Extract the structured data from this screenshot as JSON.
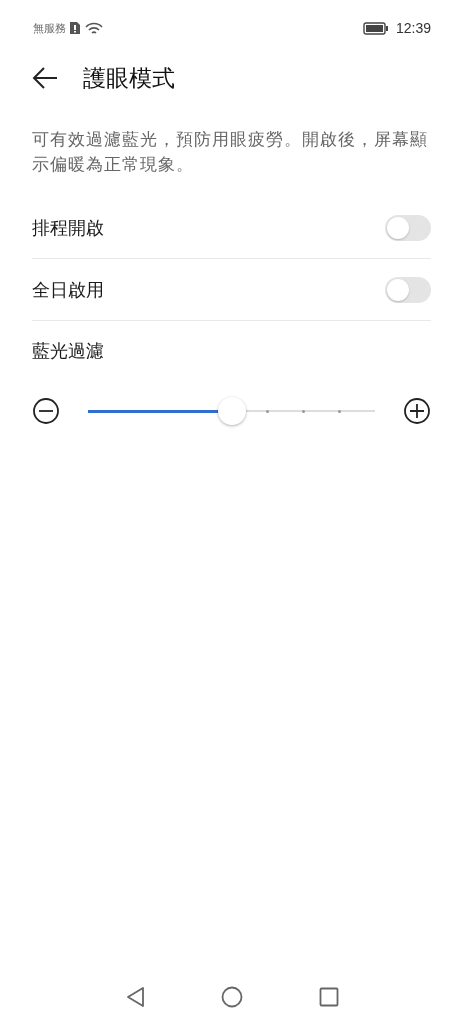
{
  "status_bar": {
    "carrier": "無服務",
    "time": "12:39"
  },
  "header": {
    "title": "護眼模式"
  },
  "description": "可有效過濾藍光，預防用眼疲勞。開啟後，屏幕顯示偏暖為正常現象。",
  "settings": [
    {
      "label": "排程開啟",
      "on": false
    },
    {
      "label": "全日啟用",
      "on": false
    }
  ],
  "filter": {
    "label": "藍光過濾",
    "level": 0.5
  }
}
